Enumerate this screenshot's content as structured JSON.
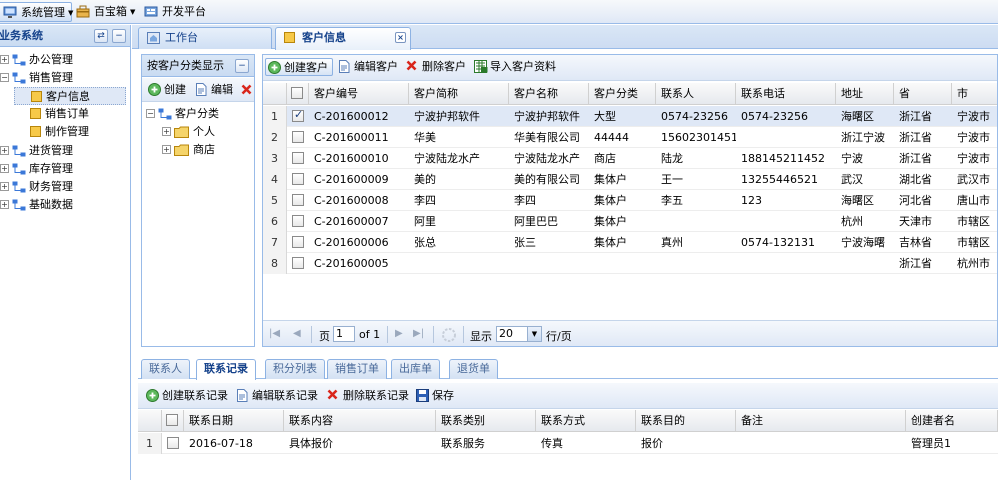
{
  "topbar": {
    "system_menu": "系统管理",
    "toolbox": "百宝箱",
    "dev_platform": "开发平台"
  },
  "sidebar": {
    "title": "业务系统",
    "items": [
      {
        "label": "办公管理",
        "expander": "+"
      },
      {
        "label": "销售管理",
        "expander": "−"
      },
      {
        "label": "客户信息"
      },
      {
        "label": "销售订单"
      },
      {
        "label": "制作管理"
      },
      {
        "label": "进货管理",
        "expander": "+"
      },
      {
        "label": "库存管理",
        "expander": "+"
      },
      {
        "label": "财务管理",
        "expander": "+"
      },
      {
        "label": "基础数据",
        "expander": "+"
      }
    ]
  },
  "tabs": {
    "workbench": "工作台",
    "customer_info": "客户信息",
    "close": "×"
  },
  "category_panel": {
    "title": "按客户分类显示",
    "create": "创建",
    "edit": "编辑",
    "root": "客户分类",
    "children": [
      "个人",
      "商店"
    ]
  },
  "grid_toolbar": {
    "create": "创建客户",
    "edit": "编辑客户",
    "delete": "删除客户",
    "import": "导入客户资料"
  },
  "grid": {
    "columns": [
      "客户编号",
      "客户简称",
      "客户名称",
      "客户分类",
      "联系人",
      "联系电话",
      "地址",
      "省",
      "市"
    ],
    "rows": [
      {
        "n": "1",
        "id": "C-201600012",
        "short": "宁波护邦软件",
        "name": "宁波护邦软件",
        "cat": "大型",
        "contact": "0574-23256",
        "phone": "0574-23256",
        "addr": "海曙区",
        "prov": "浙江省",
        "city": "宁波市",
        "checked": true
      },
      {
        "n": "2",
        "id": "C-201600011",
        "short": "华美",
        "name": "华美有限公司",
        "cat": "44444",
        "contact": "15602301451",
        "phone": "",
        "addr": "浙江宁波",
        "prov": "浙江省",
        "city": "宁波市"
      },
      {
        "n": "3",
        "id": "C-201600010",
        "short": "宁波陆龙水产",
        "name": "宁波陆龙水产",
        "cat": "商店",
        "contact": "陆龙",
        "phone": "188145211452",
        "addr": "宁波",
        "prov": "浙江省",
        "city": "宁波市"
      },
      {
        "n": "4",
        "id": "C-201600009",
        "short": "美的",
        "name": "美的有限公司",
        "cat": "集体户",
        "contact": "王一",
        "phone": "13255446521",
        "addr": "武汉",
        "prov": "湖北省",
        "city": "武汉市"
      },
      {
        "n": "5",
        "id": "C-201600008",
        "short": "李四",
        "name": "李四",
        "cat": "集体户",
        "contact": "李五",
        "phone": "123",
        "addr": "海曙区",
        "prov": "河北省",
        "city": "唐山市"
      },
      {
        "n": "6",
        "id": "C-201600007",
        "short": "阿里",
        "name": "阿里巴巴",
        "cat": "集体户",
        "contact": "",
        "phone": "",
        "addr": "杭州",
        "prov": "天津市",
        "city": "市辖区"
      },
      {
        "n": "7",
        "id": "C-201600006",
        "short": "张总",
        "name": "张三",
        "cat": "集体户",
        "contact": "真州",
        "phone": "0574-132131",
        "addr": "宁波海曙",
        "prov": "吉林省",
        "city": "市辖区"
      },
      {
        "n": "8",
        "id": "C-201600005",
        "short": "",
        "name": "",
        "cat": "",
        "contact": "",
        "phone": "",
        "addr": "",
        "prov": "浙江省",
        "city": "杭州市"
      }
    ]
  },
  "pager": {
    "page_label": "页",
    "page_value": "1",
    "of_label": "of 1",
    "show_label": "显示",
    "page_size": "20",
    "rows_label": "行/页"
  },
  "bottom_tabs": [
    "联系人",
    "联系记录",
    "积分列表",
    "销售订单",
    "出库单",
    "退货单"
  ],
  "record_toolbar": {
    "create": "创建联系记录",
    "edit": "编辑联系记录",
    "delete": "删除联系记录",
    "save": "保存"
  },
  "record_grid": {
    "columns": [
      "联系日期",
      "联系内容",
      "联系类别",
      "联系方式",
      "联系目的",
      "备注",
      "创建者名"
    ],
    "rows": [
      {
        "n": "1",
        "date": "2016-07-18",
        "content": "具体报价",
        "type": "联系服务",
        "method": "传真",
        "purpose": "报价",
        "note": "",
        "creator": "管理员1"
      }
    ]
  }
}
